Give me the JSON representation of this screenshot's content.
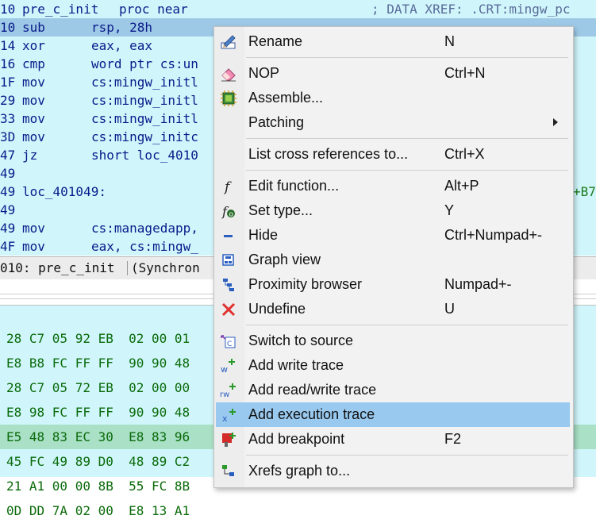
{
  "disasm": {
    "lines": [
      {
        "addr": "10",
        "mnem": "pre_c_init",
        "ops": "proc near",
        "xref": "; DATA XREF: .CRT:mingw_pc"
      },
      {
        "addr": "10",
        "mnem": "sub",
        "ops": "rsp, 28h"
      },
      {
        "addr": "14",
        "mnem": "xor",
        "ops": "eax, eax"
      },
      {
        "addr": "16",
        "mnem": "cmp",
        "ops": "word ptr cs:un"
      },
      {
        "addr": "1F",
        "mnem": "mov",
        "ops": "cs:mingw_initl"
      },
      {
        "addr": "29",
        "mnem": "mov",
        "ops": "cs:mingw_initl"
      },
      {
        "addr": "33",
        "mnem": "mov",
        "ops": "cs:mingw_initl"
      },
      {
        "addr": "3D",
        "mnem": "mov",
        "ops": "cs:mingw_initc"
      },
      {
        "addr": "47",
        "mnem": "jz",
        "ops": "short loc_4010"
      },
      {
        "addr": "49",
        "mnem": "",
        "ops": ""
      },
      {
        "addr": "49",
        "mnem": "loc_401049:",
        "ops": "",
        "xref": "+B7"
      },
      {
        "addr": "49",
        "mnem": "",
        "ops": ""
      },
      {
        "addr": "49",
        "mnem": "mov",
        "ops": "cs:managedapp,"
      },
      {
        "addr": "4F",
        "mnem": "mov",
        "ops": "eax, cs:mingw_"
      }
    ]
  },
  "status": {
    "location": "010: pre_c_init",
    "rest": "(Synchron"
  },
  "hex": {
    "lines": [
      "28 C7 05 92 EB  02 00 01",
      "E8 B8 FC FF FF  90 90 48",
      "28 C7 05 72 EB  02 00 00",
      "E8 98 FC FF FF  90 90 48",
      "E5 48 83 EC 30  E8 83 96",
      "45 FC 49 89 D0  48 89 C2",
      "21 A1 00 00 8B  55 FC 8B",
      "0D DD 7A 02 00  E8 13 A1"
    ]
  },
  "menu": {
    "items": [
      {
        "label": "Rename",
        "shortcut": "N",
        "icon": "rename-icon"
      },
      {
        "label": "NOP",
        "shortcut": "Ctrl+N",
        "icon": "eraser-icon"
      },
      {
        "label": "Assemble...",
        "shortcut": "",
        "icon": "chip-icon"
      },
      {
        "label": "Patching",
        "shortcut": "",
        "icon": ""
      },
      {
        "label": "List cross references to...",
        "shortcut": "Ctrl+X",
        "icon": ""
      },
      {
        "label": "Edit function...",
        "shortcut": "Alt+P",
        "icon": "function-icon"
      },
      {
        "label": "Set type...",
        "shortcut": "Y",
        "icon": "set-type-icon"
      },
      {
        "label": "Hide",
        "shortcut": "Ctrl+Numpad+-",
        "icon": "minus-icon"
      },
      {
        "label": "Graph view",
        "shortcut": "",
        "icon": "graph-view-icon"
      },
      {
        "label": "Proximity browser",
        "shortcut": "Numpad+-",
        "icon": "proximity-icon"
      },
      {
        "label": "Undefine",
        "shortcut": "U",
        "icon": "red-x-icon"
      },
      {
        "label": "Switch to source",
        "shortcut": "",
        "icon": "switch-source-icon"
      },
      {
        "label": "Add write trace",
        "shortcut": "",
        "icon": "write-trace-icon"
      },
      {
        "label": "Add read/write trace",
        "shortcut": "",
        "icon": "rw-trace-icon"
      },
      {
        "label": "Add execution trace",
        "shortcut": "",
        "icon": "exec-trace-icon"
      },
      {
        "label": "Add breakpoint",
        "shortcut": "F2",
        "icon": "breakpoint-icon"
      },
      {
        "label": "Xrefs graph to...",
        "shortcut": "",
        "icon": "xrefs-graph-icon"
      }
    ]
  },
  "colors": {
    "menu_highlight": "#99c9ef",
    "disasm_bg": "#d0f6fb",
    "code_text": "#0a1a8a",
    "hex_text": "#0b6b0b"
  }
}
